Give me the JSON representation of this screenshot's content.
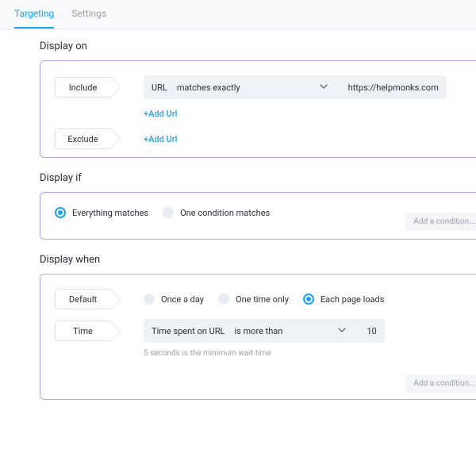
{
  "tabs": {
    "targeting": "Targeting",
    "settings": "Settings"
  },
  "displayOn": {
    "title": "Display on",
    "includeTag": "Include",
    "excludeTag": "Exclude",
    "urlLabel": "URL",
    "matchMode": "matches exactly",
    "urlValue": "https://helpmonks.com",
    "addUrl": "+Add Url"
  },
  "displayIf": {
    "title": "Display if",
    "optEverything": "Everything matches",
    "optOneCondition": "One condition matches",
    "addCondition": "Add a condition..."
  },
  "displayWhen": {
    "title": "Display when",
    "defaultTag": "Default",
    "timeTag": "Time",
    "optOnceDay": "Once a day",
    "optOneTime": "One time only",
    "optEachLoad": "Each page loads",
    "timeMetric": "Time spent on URL",
    "timeOperator": "is more than",
    "timeValue": "10",
    "timeHelper": "5 seconds is the minimum wait time",
    "addCondition": "Add a condition..."
  }
}
